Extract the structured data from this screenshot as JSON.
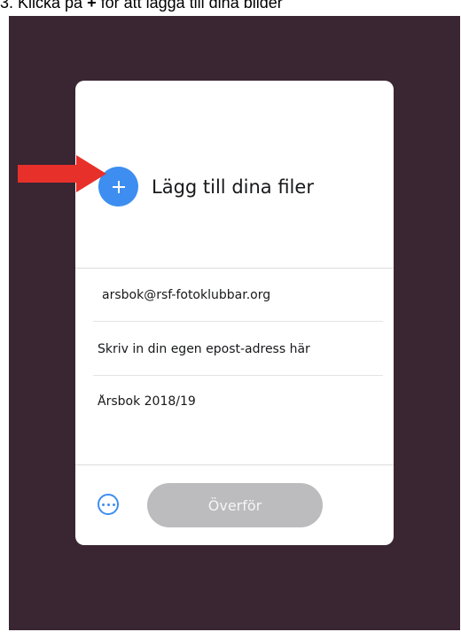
{
  "instruction": {
    "prefix": "3. Klicka på",
    "plus_symbol": "+",
    "suffix": "för att lägga till dina bilder"
  },
  "upload_card": {
    "add_files_label": "Lägg till dina filer",
    "recipient_email": "arsbok@rsf-fotoklubbar.org",
    "sender_email_placeholder": "Skriv in din egen epost-adress här",
    "message": "Årsbok 2018/19",
    "transfer_label": "Överför",
    "more_options_icon": "ellipsis-circle-icon",
    "add_icon": "plus-icon"
  },
  "annotation": {
    "arrow_icon": "red-arrow-icon",
    "arrow_color": "#e8302b"
  },
  "colors": {
    "accent": "#3d8ef0",
    "backdrop": "#3a2532",
    "disabled_button": "#bcbcbf"
  }
}
